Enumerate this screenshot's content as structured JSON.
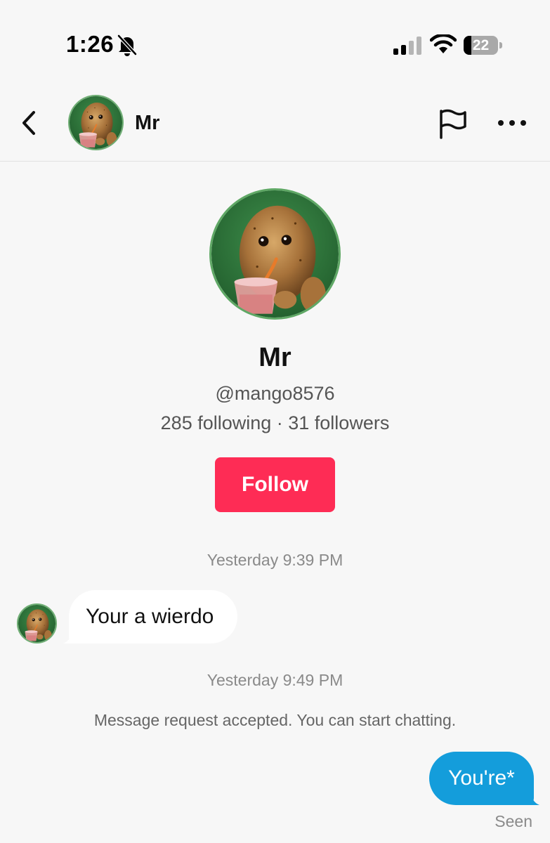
{
  "status_bar": {
    "time": "1:26",
    "battery_level": "22",
    "icons": [
      "bell-muted-icon",
      "cellular-signal-icon",
      "wifi-icon",
      "battery-icon"
    ]
  },
  "header": {
    "name": "Mr",
    "icons": [
      "back-icon",
      "flag-icon",
      "more-icon"
    ]
  },
  "profile": {
    "name": "Mr",
    "handle": "@mango8576",
    "stats": "285 following · 31 followers",
    "follow_label": "Follow"
  },
  "messages": {
    "timestamp_1": "Yesterday 9:39 PM",
    "incoming_text": "Your a wierdo",
    "timestamp_2": "Yesterday 9:49 PM",
    "system_note": "Message request accepted. You can start chatting.",
    "outgoing_text": "You're*",
    "seen_label": "Seen"
  },
  "colors": {
    "accent": "#fe2c55",
    "outgoing_bubble": "#149ddb",
    "background": "#f7f7f7"
  }
}
